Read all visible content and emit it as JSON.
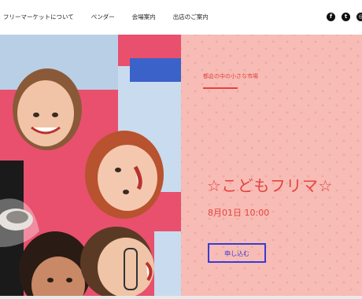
{
  "nav": {
    "items": [
      {
        "label": "フリーマーケットについて"
      },
      {
        "label": "ベンダー"
      },
      {
        "label": "会場案内"
      },
      {
        "label": "出店のご案内"
      }
    ]
  },
  "social": {
    "icons": [
      "facebook-icon",
      "twitter-icon",
      "instagram-icon"
    ]
  },
  "hero": {
    "tagline": "都会の中の小さな市場",
    "title": "☆こどもフリマ☆",
    "date": "8月01日 10:00",
    "button_label": "申し込む",
    "colors": {
      "panel_background": "#f7bcb5",
      "accent_text": "#e4433f",
      "button_border": "#3a3ad6",
      "photo_background": "#e8506e"
    }
  }
}
